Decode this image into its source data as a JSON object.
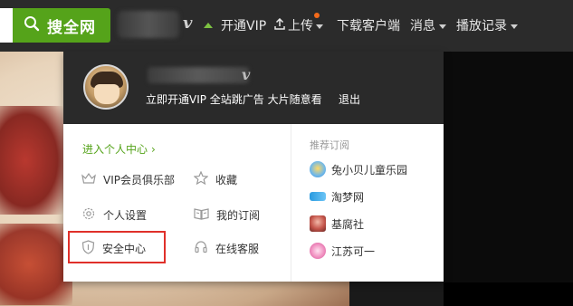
{
  "header": {
    "search_button_label": "搜全网",
    "nav": {
      "vip": "开通VIP",
      "upload": "上传",
      "download": "下载客户端",
      "messages": "消息",
      "history": "播放记录"
    }
  },
  "dropdown": {
    "promo": "立即开通VIP 全站跳广告 大片随意看",
    "logout": "退出",
    "enter_center": "进入个人中心",
    "menu": {
      "vip_club": "VIP会员俱乐部",
      "favorites": "收藏",
      "settings": "个人设置",
      "subscriptions": "我的订阅",
      "security": "安全中心",
      "service": "在线客服"
    },
    "recommend_title": "推荐订阅",
    "recommend": [
      {
        "name": "兔小贝儿童乐园"
      },
      {
        "name": "淘梦网"
      },
      {
        "name": "基腐社"
      },
      {
        "name": "江苏可一"
      }
    ]
  },
  "colors": {
    "accent_green": "#55a31a",
    "highlight_red": "#e0302a",
    "notify_dot": "#f46a1a"
  },
  "icons": [
    "search-icon",
    "upload-icon",
    "crown-icon",
    "star-icon",
    "gear-icon",
    "book-icon",
    "shield-icon",
    "headset-icon"
  ]
}
